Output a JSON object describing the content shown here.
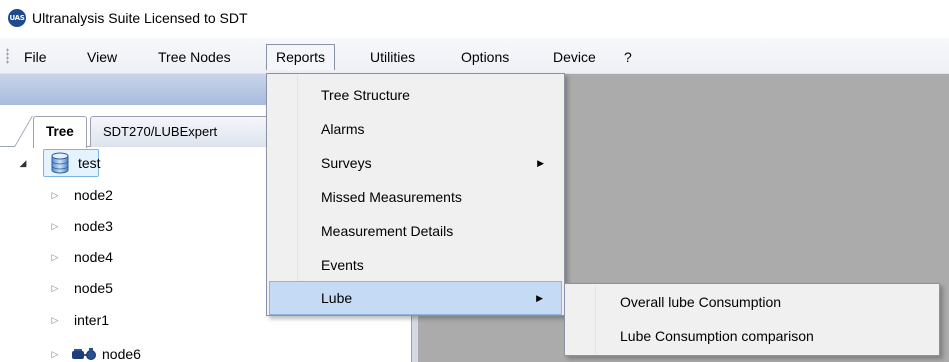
{
  "window": {
    "icon_text": "UAS",
    "title": "Ultranalysis Suite Licensed to SDT"
  },
  "menubar": {
    "items": [
      {
        "label": "File"
      },
      {
        "label": "View"
      },
      {
        "label": "Tree Nodes"
      },
      {
        "label": "Reports"
      },
      {
        "label": "Utilities"
      },
      {
        "label": "Options"
      },
      {
        "label": "Device"
      },
      {
        "label": "?"
      }
    ],
    "open_item": "Reports"
  },
  "tabs": [
    {
      "label": "Tree",
      "active": true
    },
    {
      "label": "SDT270/LUBExpert",
      "active": false
    }
  ],
  "tree": {
    "root": {
      "label": "test",
      "icon": "database-icon",
      "expanded": true,
      "selected": true
    },
    "children": [
      {
        "label": "node2",
        "icon": null
      },
      {
        "label": "node3",
        "icon": null
      },
      {
        "label": "node4",
        "icon": null
      },
      {
        "label": "node5",
        "icon": null
      },
      {
        "label": "inter1",
        "icon": null
      },
      {
        "label": "node6",
        "icon": "motor-pump-icon"
      }
    ]
  },
  "reports_menu": {
    "items": [
      {
        "label": "Tree Structure",
        "has_submenu": false
      },
      {
        "label": "Alarms",
        "has_submenu": false
      },
      {
        "label": "Surveys",
        "has_submenu": true
      },
      {
        "label": "Missed Measurements",
        "has_submenu": false
      },
      {
        "label": "Measurement Details",
        "has_submenu": false
      },
      {
        "label": "Events",
        "has_submenu": false
      },
      {
        "label": "Lube",
        "has_submenu": true,
        "highlighted": true
      }
    ],
    "submenu_arrow": "▶"
  },
  "lube_submenu": {
    "items": [
      {
        "label": "Overall lube Consumption"
      },
      {
        "label": "Lube Consumption comparison"
      }
    ]
  },
  "colors": {
    "highlight": "#c5daf4",
    "workspace": "#ababab",
    "bluebar": "#b7c8e4",
    "selection": "#e5f3ff"
  }
}
